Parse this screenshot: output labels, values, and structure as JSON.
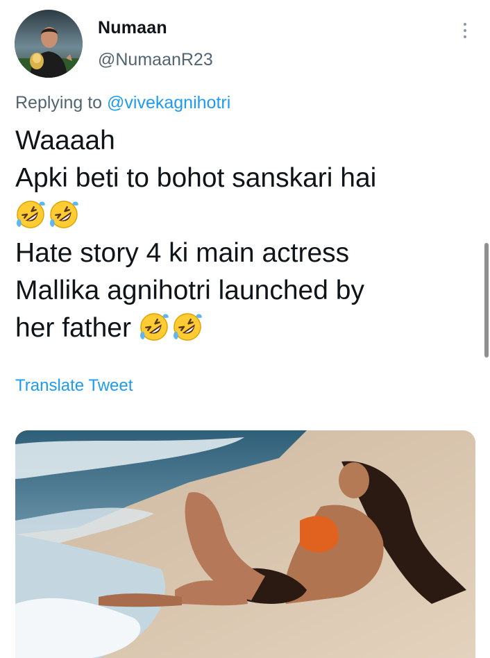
{
  "user": {
    "display_name": "Numaan",
    "handle": "@NumaanR23",
    "avatar_icon": "profile-photo"
  },
  "reply": {
    "prefix": "Replying to",
    "mention": "@vivekagnihotri"
  },
  "tweet": {
    "lines": [
      "Waaaah",
      "Apki beti to bohot sanskari hai",
      "Hate story 4 ki main actress",
      "Mallika agnihotri launched by",
      "her father"
    ],
    "emoji_icon": "rolling-on-floor-laughing-emoji"
  },
  "translate_label": "Translate Tweet",
  "menu_icon": "more-options-icon",
  "colors": {
    "link": "#1d9bf0",
    "secondary_text": "#536471",
    "primary_text": "#0f1419"
  }
}
